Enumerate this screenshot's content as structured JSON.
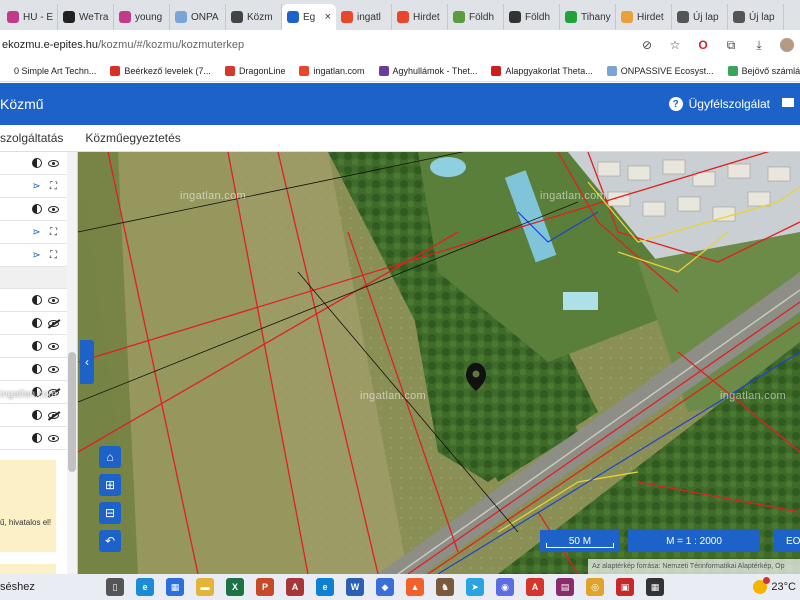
{
  "browser": {
    "tabs": [
      {
        "label": "HU - E",
        "icon": "pink-circle-icon",
        "color": "#c23b8a"
      },
      {
        "label": "WeTra",
        "icon": "we-icon",
        "color": "#222222"
      },
      {
        "label": "young",
        "icon": "pink-circle-icon",
        "color": "#c23b8a"
      },
      {
        "label": "ONPA",
        "icon": "onpassive-icon",
        "color": "#7aa3d8"
      },
      {
        "label": "Közm",
        "icon": "home-icon",
        "color": "#444444"
      },
      {
        "label": "Eg",
        "icon": "eg-icon",
        "color": "#1c62c9",
        "active": true
      },
      {
        "label": "ingatl",
        "icon": "house-red-icon",
        "color": "#e8472b"
      },
      {
        "label": "Hirdet",
        "icon": "house-red-icon",
        "color": "#e8472b"
      },
      {
        "label": "Földh",
        "icon": "globe-icon",
        "color": "#5a9c3e"
      },
      {
        "label": "Földh",
        "icon": "t-icon",
        "color": "#333333"
      },
      {
        "label": "Tihany",
        "icon": "s-icon",
        "color": "#21a33b"
      },
      {
        "label": "Hirdet",
        "icon": "star-icon",
        "color": "#e9a23b"
      },
      {
        "label": "Új lap",
        "icon": "chrome-icon",
        "color": "#555555"
      },
      {
        "label": "Új lap",
        "icon": "chrome-icon",
        "color": "#555555"
      }
    ],
    "url_host": "ekozmu.e-epites.hu",
    "url_path": "/kozmu/#/kozmu/kozmuterkep",
    "bookmarks": [
      {
        "label": "0 Simple Art Techn...",
        "color": "#ffffff"
      },
      {
        "label": "Beérkező levelek (7...",
        "color": "#d93025"
      },
      {
        "label": "DragonLine",
        "color": "#d33a2c"
      },
      {
        "label": "ingatlan.com",
        "color": "#e8472b"
      },
      {
        "label": "Agyhullámok - Thet...",
        "color": "#6a3d9a"
      },
      {
        "label": "Alapgyakorlat Theta...",
        "color": "#cc1f1f"
      },
      {
        "label": "ONPASSIVE Ecosyst...",
        "color": "#7aa3d8"
      },
      {
        "label": "Bejövő számlák | On...",
        "color": "#3aa35a"
      }
    ]
  },
  "app": {
    "title": "Közmű",
    "support_label": "Ügyfélszolgálat",
    "subnav": [
      "szolgáltatás",
      "Közműegyeztetés"
    ],
    "notice_text": "ű, hivatalos el!",
    "side_watermark": "ingatlan.com"
  },
  "map": {
    "watermark": "ingatlan.com",
    "scale_label": "50 M",
    "ratio_label": "M = 1 : 2000",
    "crs_label": "EO",
    "attribution": "Az alaptérkép forrása: Nemzeti Térinformatikai Alaptérkép, Op"
  },
  "taskbar": {
    "search_fragment": "séshez",
    "temperature": "23°C",
    "apps": [
      {
        "name": "task-view-icon",
        "color": "#555555",
        "glyph": "▯"
      },
      {
        "name": "edge-icon",
        "color": "#1b8bd6",
        "glyph": "e"
      },
      {
        "name": "store-icon",
        "color": "#2a6fdb",
        "glyph": "▦"
      },
      {
        "name": "explorer-icon",
        "color": "#e2b43b",
        "glyph": "▬"
      },
      {
        "name": "excel-icon",
        "color": "#1e7145",
        "glyph": "X"
      },
      {
        "name": "powerpoint-icon",
        "color": "#c64a2a",
        "glyph": "P"
      },
      {
        "name": "access-icon",
        "color": "#a4373a",
        "glyph": "A"
      },
      {
        "name": "edge-alt-icon",
        "color": "#0f7fd4",
        "glyph": "e"
      },
      {
        "name": "word-icon",
        "color": "#2b5fb4",
        "glyph": "W"
      },
      {
        "name": "app-blue-icon",
        "color": "#3b6fd8",
        "glyph": "◆"
      },
      {
        "name": "app-orange-icon",
        "color": "#f0612c",
        "glyph": "▲"
      },
      {
        "name": "app-game-icon",
        "color": "#7a5a3a",
        "glyph": "♞"
      },
      {
        "name": "telegram-icon",
        "color": "#2aa3e0",
        "glyph": "➤"
      },
      {
        "name": "messenger-icon",
        "color": "#5b6de0",
        "glyph": "◉"
      },
      {
        "name": "acrobat-icon",
        "color": "#d4352c",
        "glyph": "A"
      },
      {
        "name": "winrar-icon",
        "color": "#8b2b6b",
        "glyph": "▤"
      },
      {
        "name": "chrome-icon",
        "color": "#e0a42a",
        "glyph": "◎"
      },
      {
        "name": "app-red-icon",
        "color": "#c42a2a",
        "glyph": "▣"
      },
      {
        "name": "app-dark-icon",
        "color": "#333333",
        "glyph": "▦"
      }
    ]
  }
}
